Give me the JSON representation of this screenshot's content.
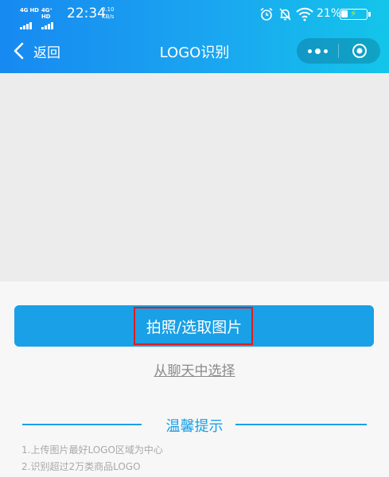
{
  "status_bar": {
    "network_1": "4G HD",
    "network_2": "4G⁺ HD",
    "time": "22:34",
    "speed_value": "0.10",
    "speed_unit": "KB/s",
    "battery_percent": "21%",
    "icons": [
      "alarm-icon",
      "bell-muted-icon",
      "wifi-icon",
      "battery-charging-icon"
    ]
  },
  "navbar": {
    "back_label": "返回",
    "title": "LOGO识别",
    "icons": [
      "back-chevron-icon",
      "more-dots-icon",
      "close-target-icon"
    ]
  },
  "main": {
    "primary_button_label": "拍照/选取图片",
    "chat_link_label": "从聊天中选择",
    "tips_title": "温馨提示",
    "tips": [
      "1.上传图片最好LOGO区域为中心",
      "2.识别超过2万类商品LOGO"
    ]
  },
  "colors": {
    "accent": "#1aa0e6",
    "header_start": "#1789f1",
    "header_end": "#13c5ea",
    "highlight": "#e21b1b"
  }
}
